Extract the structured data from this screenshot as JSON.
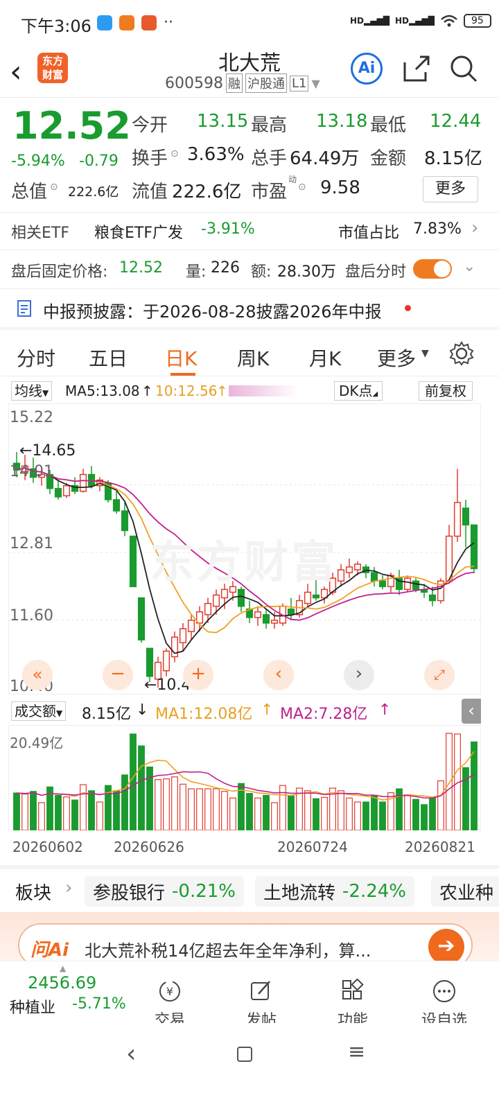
{
  "status_bar": {
    "time": "下午3:06",
    "battery": "95",
    "net1": "HD",
    "net2": "HD"
  },
  "header": {
    "logo": "东方财富",
    "name": "北大荒",
    "code": "600598",
    "tags": [
      "融",
      "沪股通",
      "L1"
    ],
    "ai_label": "Ai"
  },
  "quote": {
    "price": "12.52",
    "change_pct": "-5.94%",
    "change": "-0.79",
    "open_label": "今开",
    "open": "13.15",
    "high_label": "最高",
    "high": "13.18",
    "low_label": "最低",
    "low": "12.44",
    "turnover_label": "换手",
    "turnover": "3.63%",
    "volume_label": "总手",
    "volume": "64.49万",
    "amount_label": "金额",
    "amount": "8.15亿",
    "mktcap_label": "总值",
    "mktcap": "222.6亿",
    "float_label": "流值",
    "float": "222.6亿",
    "pe_label": "市盈",
    "pe_sup": "动",
    "pe": "9.58",
    "more": "更多"
  },
  "etf": {
    "label": "相关ETF",
    "name": "粮食ETF广发",
    "pct": "-3.91%",
    "ratio_label": "市值占比",
    "ratio": "7.83%"
  },
  "after_hours": {
    "price_label": "盘后固定价格:",
    "price": "12.52",
    "vol_label": "量:",
    "vol": "226",
    "amt_label": "额:",
    "amt": "28.30万",
    "switch_label": "盘后分时"
  },
  "notice": {
    "text": "中报预披露：于2026-08-28披露2026年中报"
  },
  "tabs": [
    "分时",
    "五日",
    "日K",
    "周K",
    "月K",
    "更多"
  ],
  "chart_toolbar": {
    "ma_select": "均线",
    "ma5": "MA5:13.08",
    "ma10": "10:12.56",
    "dk": "DK点",
    "adjust": "前复权"
  },
  "kline": {
    "price_ticks": [
      "15.22",
      "14.01",
      "12.81",
      "11.60",
      "10.40"
    ],
    "high_mark": "←14.65",
    "low_mark": "←10.40",
    "watermark": "东方财富",
    "colors": {
      "up": "#e03a2e",
      "down": "#1a9b2f",
      "ma5": "#222222",
      "ma10": "#f0a020",
      "ma20": "#c0208c"
    }
  },
  "volume_panel": {
    "select": "成交额",
    "value": "8.15亿",
    "ma1": "MA1:12.08亿",
    "ma2": "MA2:7.28亿",
    "max_label": "20.49亿"
  },
  "dates": [
    "20260602",
    "20260626",
    "20260724",
    "20260821"
  ],
  "sectors": {
    "label": "板块",
    "items": [
      {
        "name": "参股银行",
        "pct": "-0.21%"
      },
      {
        "name": "土地流转",
        "pct": "-2.24%"
      },
      {
        "name": "农业种",
        "pct": ""
      }
    ]
  },
  "ai_bar": {
    "brand": "问Ai",
    "text": "北大荒补税14亿超去年全年净利，算..."
  },
  "bottom": {
    "index_value": "2456.69",
    "index_name": "种植业",
    "index_pct": "-5.71%",
    "items": [
      "交易",
      "发帖",
      "功能",
      "设自选"
    ]
  },
  "chart_data": {
    "type": "candlestick",
    "title": "",
    "x_dates_shown": [
      "20260602",
      "20260626",
      "20260724",
      "20260821"
    ],
    "ylim": [
      10.4,
      15.22
    ],
    "ohlc": [
      [
        14.4,
        14.6,
        14.15,
        14.28
      ],
      [
        14.25,
        14.55,
        14.1,
        14.35
      ],
      [
        14.3,
        14.5,
        14.05,
        14.15
      ],
      [
        14.15,
        14.3,
        14.0,
        14.2
      ],
      [
        14.2,
        14.28,
        13.85,
        13.95
      ],
      [
        13.95,
        14.1,
        13.75,
        13.8
      ],
      [
        13.82,
        14.05,
        13.78,
        14.0
      ],
      [
        14.0,
        14.15,
        13.85,
        13.9
      ],
      [
        13.9,
        14.3,
        13.88,
        14.2
      ],
      [
        14.2,
        14.35,
        13.95,
        14.0
      ],
      [
        14.0,
        14.15,
        13.9,
        14.1
      ],
      [
        14.05,
        14.1,
        13.7,
        13.75
      ],
      [
        13.75,
        13.9,
        13.5,
        13.55
      ],
      [
        13.55,
        13.7,
        13.1,
        13.2
      ],
      [
        13.1,
        13.1,
        12.2,
        12.2
      ],
      [
        12.0,
        12.0,
        11.2,
        11.25
      ],
      [
        11.1,
        11.1,
        10.5,
        10.6
      ],
      [
        10.55,
        10.95,
        10.4,
        10.85
      ],
      [
        10.7,
        11.1,
        10.6,
        11.05
      ],
      [
        10.95,
        11.4,
        10.85,
        11.3
      ],
      [
        11.2,
        11.55,
        11.05,
        11.45
      ],
      [
        11.4,
        11.7,
        11.25,
        11.6
      ],
      [
        11.55,
        11.85,
        11.4,
        11.75
      ],
      [
        11.7,
        12.0,
        11.55,
        11.9
      ],
      [
        11.85,
        12.15,
        11.7,
        12.05
      ],
      [
        12.0,
        12.25,
        11.8,
        12.15
      ],
      [
        12.1,
        12.3,
        11.95,
        12.2
      ],
      [
        12.15,
        12.2,
        11.75,
        11.85
      ],
      [
        11.8,
        11.95,
        11.55,
        11.65
      ],
      [
        11.65,
        11.85,
        11.5,
        11.75
      ],
      [
        11.7,
        11.8,
        11.45,
        11.55
      ],
      [
        11.55,
        11.75,
        11.45,
        11.6
      ],
      [
        11.55,
        11.9,
        11.5,
        11.85
      ],
      [
        11.8,
        12.0,
        11.6,
        11.7
      ],
      [
        11.7,
        12.05,
        11.65,
        11.95
      ],
      [
        11.9,
        12.25,
        11.85,
        12.1
      ],
      [
        12.05,
        12.35,
        11.95,
        12.0
      ],
      [
        12.0,
        12.2,
        11.9,
        12.15
      ],
      [
        12.1,
        12.45,
        12.05,
        12.35
      ],
      [
        12.3,
        12.6,
        12.2,
        12.5
      ],
      [
        12.45,
        12.7,
        12.35,
        12.55
      ],
      [
        12.5,
        12.65,
        12.4,
        12.6
      ],
      [
        12.55,
        12.6,
        12.35,
        12.45
      ],
      [
        12.45,
        12.55,
        12.2,
        12.3
      ],
      [
        12.3,
        12.4,
        12.15,
        12.2
      ],
      [
        12.2,
        12.45,
        12.1,
        12.4
      ],
      [
        12.35,
        12.5,
        12.05,
        12.15
      ],
      [
        12.15,
        12.4,
        12.1,
        12.35
      ],
      [
        12.3,
        12.35,
        12.1,
        12.15
      ],
      [
        12.15,
        12.25,
        12.0,
        12.1
      ],
      [
        12.05,
        12.2,
        11.85,
        11.95
      ],
      [
        11.95,
        12.35,
        11.9,
        12.3
      ],
      [
        12.3,
        13.3,
        12.25,
        13.1
      ],
      [
        13.1,
        14.3,
        13.0,
        13.7
      ],
      [
        13.6,
        13.75,
        12.9,
        13.3
      ],
      [
        13.3,
        13.3,
        12.44,
        12.52
      ]
    ],
    "volume_ylim_label": "20.49亿"
  }
}
